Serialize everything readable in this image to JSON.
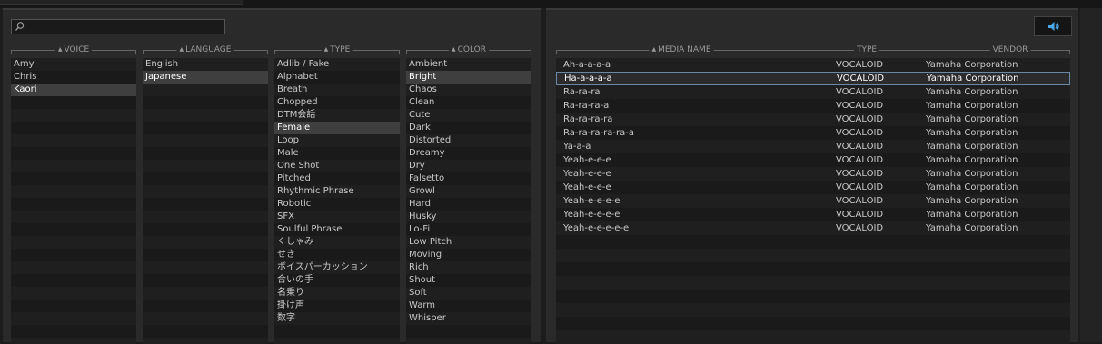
{
  "search": {
    "value": "",
    "placeholder": ""
  },
  "filters": {
    "voice": {
      "header": "VOICE",
      "items": [
        "Amy",
        "Chris",
        "Kaori"
      ],
      "selected_index": 2
    },
    "language": {
      "header": "LANGUAGE",
      "items": [
        "English",
        "Japanese"
      ],
      "selected_index": 1
    },
    "type": {
      "header": "TYPE",
      "items": [
        "Adlib / Fake",
        "Alphabet",
        "Breath",
        "Chopped",
        "DTM会話",
        "Female",
        "Loop",
        "Male",
        "One Shot",
        "Pitched",
        "Rhythmic Phrase",
        "Robotic",
        "SFX",
        "Soulful Phrase",
        "くしゃみ",
        "せき",
        "ボイスパーカッション",
        "合いの手",
        "名乗り",
        "掛け声",
        "数字"
      ],
      "selected_index": 5
    },
    "color": {
      "header": "COLOR",
      "items": [
        "Ambient",
        "Bright",
        "Chaos",
        "Clean",
        "Cute",
        "Dark",
        "Distorted",
        "Dreamy",
        "Dry",
        "Falsetto",
        "Growl",
        "Hard",
        "Husky",
        "Lo-Fi",
        "Low Pitch",
        "Moving",
        "Rich",
        "Shout",
        "Soft",
        "Warm",
        "Whisper"
      ],
      "selected_index": 1
    }
  },
  "media": {
    "columns": {
      "name": "MEDIA NAME",
      "type": "TYPE",
      "vendor": "VENDOR"
    },
    "rows": [
      {
        "name": "Ah-a-a-a-a",
        "type": "VOCALOID",
        "vendor": "Yamaha Corporation"
      },
      {
        "name": "Ha-a-a-a-a",
        "type": "VOCALOID",
        "vendor": "Yamaha Corporation"
      },
      {
        "name": "Ra-ra-ra",
        "type": "VOCALOID",
        "vendor": "Yamaha Corporation"
      },
      {
        "name": "Ra-ra-ra-a",
        "type": "VOCALOID",
        "vendor": "Yamaha Corporation"
      },
      {
        "name": "Ra-ra-ra-ra",
        "type": "VOCALOID",
        "vendor": "Yamaha Corporation"
      },
      {
        "name": "Ra-ra-ra-ra-ra-a",
        "type": "VOCALOID",
        "vendor": "Yamaha Corporation"
      },
      {
        "name": "Ya-a-a",
        "type": "VOCALOID",
        "vendor": "Yamaha Corporation"
      },
      {
        "name": "Yeah-e-e-e",
        "type": "VOCALOID",
        "vendor": "Yamaha Corporation"
      },
      {
        "name": "Yeah-e-e-e",
        "type": "VOCALOID",
        "vendor": "Yamaha Corporation"
      },
      {
        "name": "Yeah-e-e-e",
        "type": "VOCALOID",
        "vendor": "Yamaha Corporation"
      },
      {
        "name": "Yeah-e-e-e-e",
        "type": "VOCALOID",
        "vendor": "Yamaha Corporation"
      },
      {
        "name": "Yeah-e-e-e-e",
        "type": "VOCALOID",
        "vendor": "Yamaha Corporation"
      },
      {
        "name": "Yeah-e-e-e-e-e",
        "type": "VOCALOID",
        "vendor": "Yamaha Corporation"
      }
    ],
    "selected_index": 1
  },
  "icons": {
    "search": "magnifier-icon",
    "preview": "speaker-icon"
  },
  "colors": {
    "background": "#2a2a2a",
    "selected_row": "#3f3f3f",
    "selection_border": "#6d87a6",
    "speaker_accent": "#4aa8e8"
  }
}
